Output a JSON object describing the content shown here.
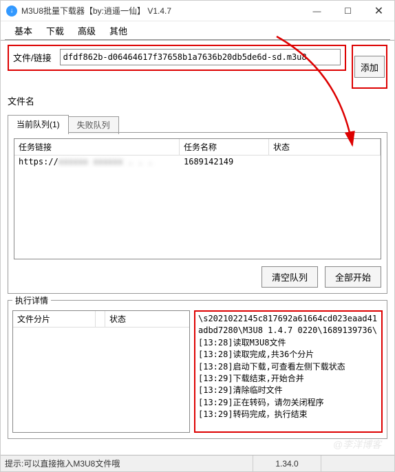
{
  "title": "M3U8批量下载器【by:逍遥一仙】  V1.4.7",
  "window_buttons": {
    "min": "—",
    "max": "☐",
    "close": "✕"
  },
  "menu": {
    "basic": "基本",
    "download": "下载",
    "advanced": "高级",
    "other": "其他"
  },
  "labels": {
    "file_link": "文件/链接",
    "file_name": "文件名",
    "add": "添加",
    "clear_queue": "清空队列",
    "start_all": "全部开始",
    "exec_detail": "执行详情"
  },
  "input": {
    "url_value": "dfdf862b-d06464617f37658b1a7636b20db5de6d-sd.m3u8"
  },
  "tabs": {
    "current": "当前队列(1)",
    "failed": "失败队列"
  },
  "task_table": {
    "headers": {
      "link": "任务链接",
      "name": "任务名称",
      "status": "状态"
    },
    "rows": [
      {
        "link_prefix": "https://",
        "link_rest": "xxxxxx xxxxxx . . .",
        "name": "1689142149",
        "status": ""
      }
    ]
  },
  "slice_table": {
    "headers": {
      "slice": "文件分片",
      "status": "状态"
    }
  },
  "log_lines": [
    "\\s2021022145c817692a61664cd023eaad41adbd7280\\M3U8 1.4.7 0220\\1689139736\\",
    "[13:28]读取M3U8文件",
    "[13:28]读取完成,共36个分片",
    "[13:28]启动下载,可查看左侧下载状态",
    "[13:29]下载结束,开始合并",
    "[13:29]清除临时文件",
    "[13:29]正在转码，请勿关闭程序",
    "[13:29]转码完成，执行结束"
  ],
  "statusbar": {
    "hint": "提示:可以直接拖入M3U8文件哦",
    "version": "1.34.0"
  },
  "watermark": "@李洋博客"
}
